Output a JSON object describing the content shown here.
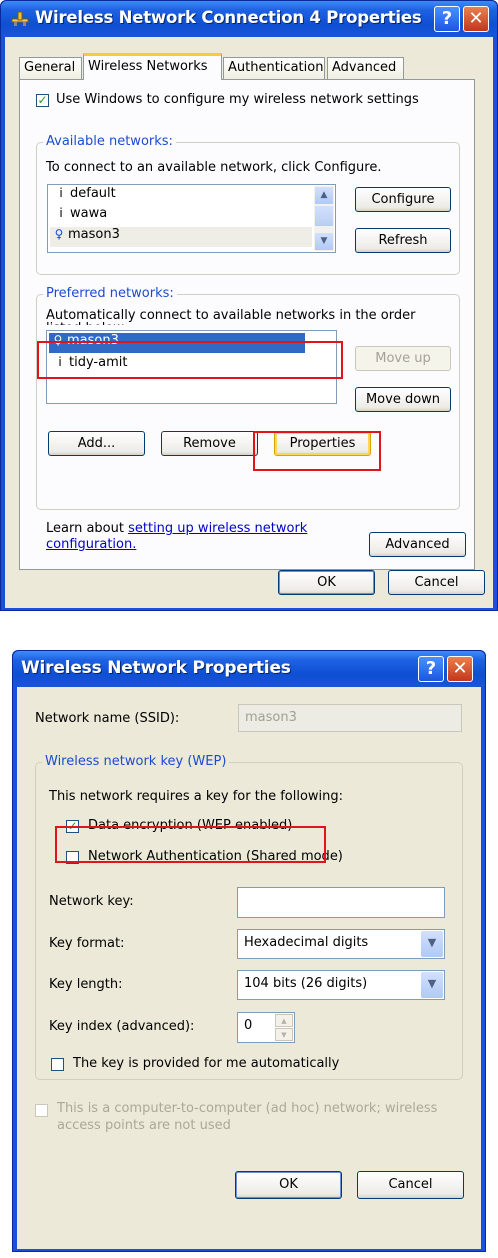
{
  "dialog1": {
    "title": "Wireless Network Connection 4 Properties",
    "help_glyph": "?",
    "close_glyph": "✕",
    "tabs": [
      "General",
      "Wireless Networks",
      "Authentication",
      "Advanced"
    ],
    "use_windows_label": "Use Windows to configure my wireless network settings",
    "use_windows_checked": true,
    "available": {
      "legend": "Available networks:",
      "instructions": "To connect to an available network, click Configure.",
      "items": [
        {
          "name": "default",
          "icon": "antenna-icon"
        },
        {
          "name": "wawa",
          "icon": "antenna-icon"
        },
        {
          "name": "mason3",
          "icon": "access-point-icon"
        }
      ],
      "configure_label": "Configure",
      "refresh_label": "Refresh"
    },
    "preferred": {
      "legend": "Preferred networks:",
      "instructions": "Automatically connect to available networks in the order listed below:",
      "items": [
        {
          "name": "mason3",
          "icon": "access-point-icon",
          "selected": true
        },
        {
          "name": "tidy-amit",
          "icon": "antenna-icon",
          "selected": false
        }
      ],
      "move_up_label": "Move up",
      "move_down_label": "Move down",
      "add_label": "Add...",
      "remove_label": "Remove",
      "properties_label": "Properties"
    },
    "learn_prefix": "Learn about ",
    "learn_link": "setting up wireless network configuration.",
    "advanced_label": "Advanced",
    "ok_label": "OK",
    "cancel_label": "Cancel"
  },
  "dialog2": {
    "title": "Wireless Network Properties",
    "help_glyph": "?",
    "close_glyph": "✕",
    "ssid_label": "Network name (SSID):",
    "ssid_value": "mason3",
    "group_legend": "Wireless network key (WEP)",
    "requires_label": "This network requires a key for the following:",
    "data_encryption_label": "Data encryption (WEP enabled)",
    "data_encryption_checked": true,
    "net_auth_label": "Network Authentication (Shared mode)",
    "net_auth_checked": false,
    "network_key_label": "Network key:",
    "network_key_value": "",
    "key_format_label": "Key format:",
    "key_format_value": "Hexadecimal digits",
    "key_length_label": "Key length:",
    "key_length_value": "104 bits (26 digits)",
    "key_index_label": "Key index (advanced):",
    "key_index_value": "0",
    "auto_key_label": "The key is provided for me automatically",
    "auto_key_checked": false,
    "adhoc_label_line1": "This is a computer-to-computer (ad hoc) network; wireless",
    "adhoc_label_line2": "access points are not used",
    "ok_label": "OK",
    "cancel_label": "Cancel"
  },
  "colors": {
    "title_blue": "#0f4fd3",
    "highlight_red": "#e0141a",
    "face": "#ece9d8",
    "check_green": "#21a121"
  }
}
